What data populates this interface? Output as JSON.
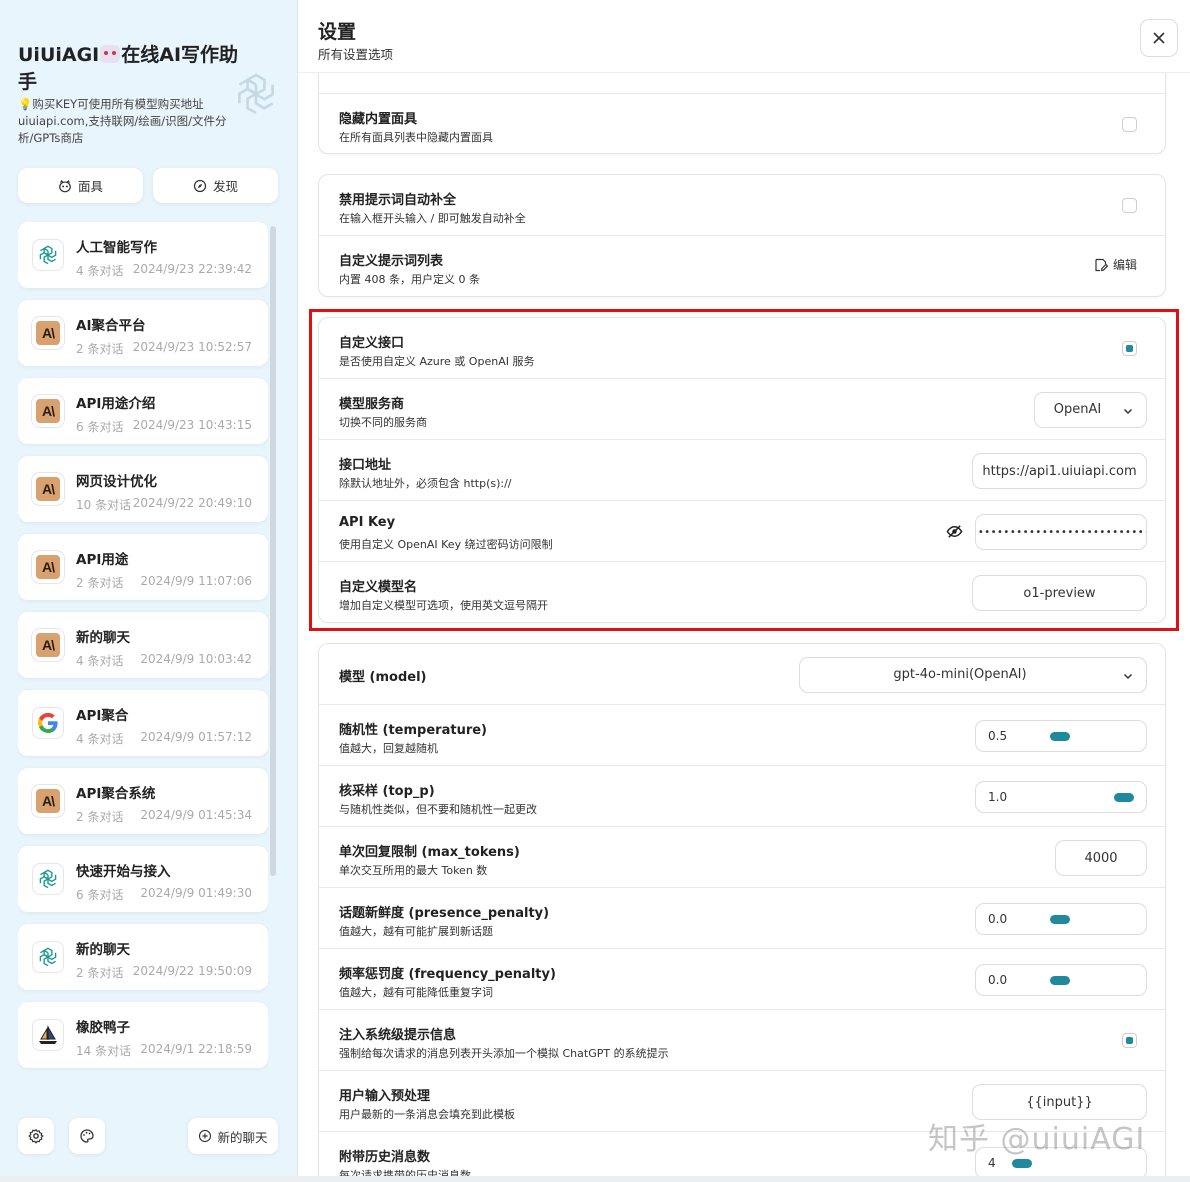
{
  "sidebar": {
    "title_prefix": "UiUiAGI",
    "title_suffix": "在线AI写作助手",
    "subtitle_bulb": "💡",
    "subtitle": "购买KEY可使用所有模型购买地址uiuiapi.com,支持联网/绘画/识图/文件分析/GPTs商店",
    "mask_button": "面具",
    "discover_button": "发现",
    "new_chat_button": "新的聊天",
    "chats": [
      {
        "title": "人工智能写作",
        "count": "4 条对话",
        "time": "2024/9/23 22:39:42",
        "icon": "openai-icon"
      },
      {
        "title": "AI聚合平台",
        "count": "2 条对话",
        "time": "2024/9/23 10:52:57",
        "icon": "claude-icon"
      },
      {
        "title": "API用途介绍",
        "count": "6 条对话",
        "time": "2024/9/23 10:43:15",
        "icon": "claude-icon"
      },
      {
        "title": "网页设计优化",
        "count": "10 条对话",
        "time": "2024/9/22 20:49:10",
        "icon": "claude-icon"
      },
      {
        "title": "API用途",
        "count": "2 条对话",
        "time": "2024/9/9 11:07:06",
        "icon": "claude-icon"
      },
      {
        "title": "新的聊天",
        "count": "4 条对话",
        "time": "2024/9/9 10:03:42",
        "icon": "claude-icon"
      },
      {
        "title": "API聚合",
        "count": "4 条对话",
        "time": "2024/9/9 01:57:12",
        "icon": "google-icon"
      },
      {
        "title": "API聚合系统",
        "count": "2 条对话",
        "time": "2024/9/9 01:45:34",
        "icon": "claude-icon"
      },
      {
        "title": "快速开始与接入",
        "count": "6 条对话",
        "time": "2024/9/9 01:49:30",
        "icon": "openai-icon"
      },
      {
        "title": "新的聊天",
        "count": "2 条对话",
        "time": "2024/9/22 19:50:09",
        "icon": "openai-icon"
      },
      {
        "title": "橡胶鸭子",
        "count": "14 条对话",
        "time": "2024/9/1 22:18:59",
        "icon": "sailboat-icon"
      }
    ]
  },
  "header": {
    "title": "设置",
    "subtitle": "所有设置选项"
  },
  "settings": {
    "hide_builtin_masks": {
      "title": "隐藏内置面具",
      "desc": "在所有面具列表中隐藏内置面具",
      "checked": false
    },
    "disable_autocomplete": {
      "title": "禁用提示词自动补全",
      "desc": "在输入框开头输入 / 即可触发自动补全",
      "checked": false
    },
    "custom_prompts": {
      "title": "自定义提示词列表",
      "desc": "内置 408 条，用户定义 0 条",
      "button": "编辑"
    },
    "custom_endpoint": {
      "title": "自定义接口",
      "desc": "是否使用自定义 Azure 或 OpenAI 服务",
      "checked": true
    },
    "provider": {
      "title": "模型服务商",
      "desc": "切换不同的服务商",
      "value": "OpenAI"
    },
    "endpoint": {
      "title": "接口地址",
      "desc": "除默认地址外，必须包含 http(s)://",
      "value": "https://api1.uiuiapi.com"
    },
    "api_key": {
      "title": "API Key",
      "desc": "使用自定义 OpenAI Key 绕过密码访问限制",
      "value": "••••••••••••••••••••••••••••••••••"
    },
    "custom_models": {
      "title": "自定义模型名",
      "desc": "增加自定义模型可选项，使用英文逗号隔开",
      "value": "o1-preview"
    },
    "model": {
      "title": "模型 (model)",
      "value": "gpt-4o-mini(OpenAI)"
    },
    "temperature": {
      "title": "随机性 (temperature)",
      "desc": "值越大，回复越随机",
      "value": "0.5",
      "level": 0.5
    },
    "top_p": {
      "title": "核采样 (top_p)",
      "desc": "与随机性类似，但不要和随机性一起更改",
      "value": "1.0",
      "level": 1.0
    },
    "max_tokens": {
      "title": "单次回复限制 (max_tokens)",
      "desc": "单次交互所用的最大 Token 数",
      "value": "4000"
    },
    "presence_penalty": {
      "title": "话题新鲜度 (presence_penalty)",
      "desc": "值越大，越有可能扩展到新话题",
      "value": "0.0",
      "level": 0.5
    },
    "frequency_penalty": {
      "title": "频率惩罚度 (frequency_penalty)",
      "desc": "值越大，越有可能降低重复字词",
      "value": "0.0",
      "level": 0.5
    },
    "inject_system": {
      "title": "注入系统级提示信息",
      "desc": "强制给每次请求的消息列表开头添加一个模拟 ChatGPT 的系统提示",
      "checked": true
    },
    "input_template": {
      "title": "用户输入预处理",
      "desc": "用户最新的一条消息会填充到此模板",
      "value": "{{input}}"
    },
    "history_count": {
      "title": "附带历史消息数",
      "desc": "每次请求携带的历史消息数",
      "value": "4",
      "level": 0.2
    }
  },
  "watermark": "知乎 @uiuiAGI",
  "colors": {
    "accent": "#1f8a9e",
    "highlight": "#e01010",
    "sidebar_bg": "#e8f5fc"
  }
}
